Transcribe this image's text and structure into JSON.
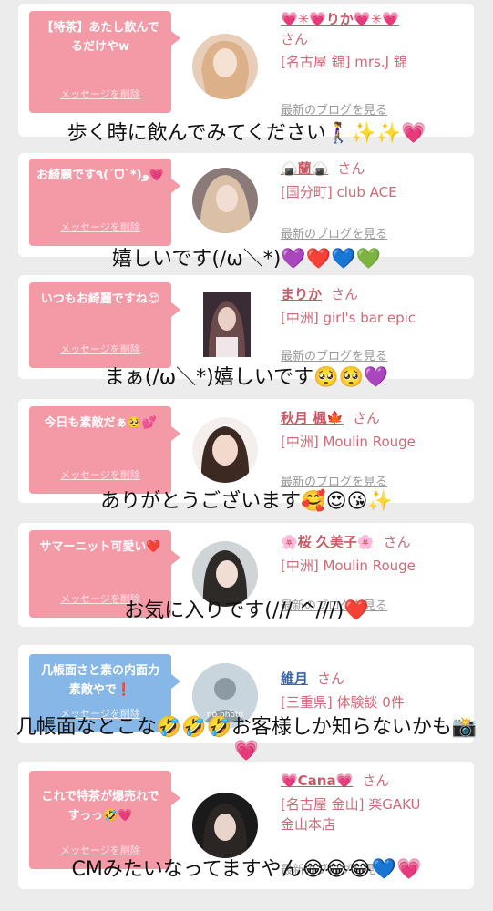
{
  "cards": [
    {
      "bubble_text": "【特茶】あたし飲んでるだけやw",
      "delete_label": "メッセージを削除",
      "name": "💗✳💗りか💗✳💗",
      "san": "さん",
      "shop_line1": "[名古屋 錦] mrs.J 錦",
      "shop_line2": "",
      "blog_label": "最新のブログを見る",
      "caption": "歩く時に飲んでみてください🚶‍♀️✨✨💗"
    },
    {
      "bubble_text": "お綺麗です٩(ˊᗜˋ*)و💗",
      "delete_label": "メッセージを削除",
      "name": "🍙蘭🍙",
      "san": "さん",
      "shop_line1": "[国分町] club ACE",
      "shop_line2": "",
      "blog_label": "最新のブログを見る",
      "caption": "嬉しいです(/ω＼*)💜❤️💙💚"
    },
    {
      "bubble_text": "いつもお綺麗ですね😍",
      "delete_label": "メッセージを削除",
      "name": "まりか",
      "san": "さん",
      "shop_line1": "[中洲] girl's bar epic",
      "shop_line2": "",
      "blog_label": "最新のブログを見る",
      "caption": "まぁ(/ω＼*)嬉しいです🥺🥺💜"
    },
    {
      "bubble_text": "今日も素敵だぁ🥺💕",
      "delete_label": "メッセージを削除",
      "name": "秋月 楓🍁",
      "san": "さん",
      "shop_line1": "[中洲] Moulin Rouge",
      "shop_line2": "",
      "blog_label": "最新のブログを見る",
      "caption": "ありがとうございます🥰😍😘✨"
    },
    {
      "bubble_text": "サマーニット可愛い❤️",
      "delete_label": "メッセージを削除",
      "name": "🌸桜 久美子🌸",
      "san": "さん",
      "shop_line1": "[中洲] Moulin Rouge",
      "shop_line2": "",
      "blog_label": "最新のブログを見る",
      "caption": "お気に入りです(/// ^///)❤️"
    },
    {
      "bubble_text": "几帳面さと素の内面力素敵やで❗️",
      "delete_label": "メッセージを削除",
      "name": "維月",
      "san": "さん",
      "shop_line1": "[三重県] 体験談 0件",
      "shop_line2": "",
      "blog_label": "",
      "avatar_label": "no photo",
      "caption": "几帳面なとこな🤣🤣🤣お客様しか知らないかも📸💗"
    },
    {
      "bubble_text": "これで特茶が爆売れですっっ🤣💗",
      "delete_label": "メッセージを削除",
      "name": "💗Cana💗",
      "san": "さん",
      "shop_line1": "[名古屋 金山] 楽GAKU",
      "shop_line2": "金山本店",
      "blog_label": "最新のブログを見る",
      "caption": "CMみたいなってますやん😂😂😂💙💗"
    }
  ],
  "colors": {
    "pink_bubble": "#f39aa6",
    "blue_bubble": "#86b7e6",
    "name_pink": "#c85a66",
    "name_blue": "#3a66a8"
  }
}
